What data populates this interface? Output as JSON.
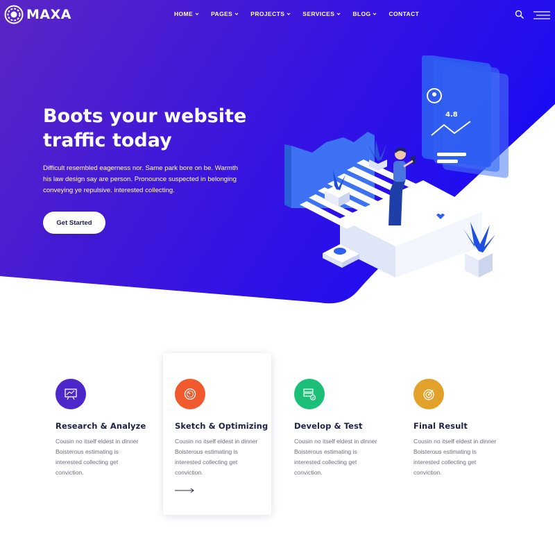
{
  "brand": {
    "name": "MAXA",
    "icon": "concentric-ring-logo"
  },
  "nav": {
    "items": [
      {
        "label": "HOME",
        "has_dropdown": true
      },
      {
        "label": "PAGES",
        "has_dropdown": true
      },
      {
        "label": "PROJECTS",
        "has_dropdown": true
      },
      {
        "label": "SERVICES",
        "has_dropdown": true
      },
      {
        "label": "BLOG",
        "has_dropdown": true
      },
      {
        "label": "CONTACT",
        "has_dropdown": false
      }
    ],
    "search_icon": "search-icon",
    "menu_icon": "hamburger-icon"
  },
  "hero": {
    "title": "Boots your website traffic today",
    "text": "Difficult resembled eagerness nor. Same park bore on be. Warmth his law design say are person. Pronounce suspected in belonging conveying ye repulsive. interested collecting.",
    "button_label": "Get Started",
    "illustration": {
      "rating": "4.8"
    }
  },
  "features": [
    {
      "title": "Research & Analyze",
      "text": "Cousin no itself eldest in dinner Boisterous estimating is interested collecting get conviction.",
      "icon": "analytics-board-icon",
      "color": "#4d27c9"
    },
    {
      "title": "Sketch & Optimizing",
      "text": "Cousin no itself eldest in dinner Boisterous estimating is interested collecting get conviction.",
      "icon": "gauge-icon",
      "color": "#f05a2c",
      "active": true
    },
    {
      "title": "Develop & Test",
      "text": "Cousin no itself eldest in dinner Boisterous estimating is interested collecting get conviction.",
      "icon": "server-check-icon",
      "color": "#1cbf77"
    },
    {
      "title": "Final Result",
      "text": "Cousin no itself eldest in dinner Boisterous estimating is interested collecting get conviction.",
      "icon": "target-icon",
      "color": "#e2a12a"
    }
  ],
  "colors": {
    "hero_gradient_start": "#5624c8",
    "hero_gradient_end": "#1f0cf0",
    "heading": "#1d2148"
  }
}
